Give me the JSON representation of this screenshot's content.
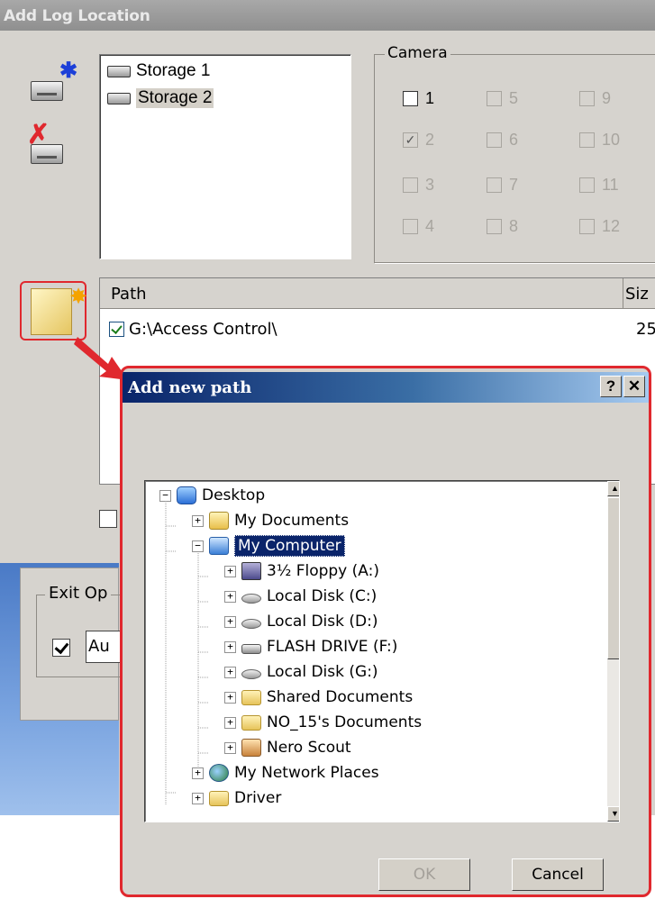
{
  "window": {
    "title": "Add Log Location"
  },
  "storage": {
    "items": [
      "Storage 1",
      "Storage 2"
    ]
  },
  "camera": {
    "legend": "Camera",
    "cameras": [
      {
        "label": "1",
        "checked": false,
        "enabled": true
      },
      {
        "label": "2",
        "checked": true,
        "enabled": false
      },
      {
        "label": "3",
        "checked": false,
        "enabled": false
      },
      {
        "label": "4",
        "checked": false,
        "enabled": false
      },
      {
        "label": "5",
        "checked": false,
        "enabled": false
      },
      {
        "label": "6",
        "checked": false,
        "enabled": false
      },
      {
        "label": "7",
        "checked": false,
        "enabled": false
      },
      {
        "label": "8",
        "checked": false,
        "enabled": false
      },
      {
        "label": "9",
        "checked": false,
        "enabled": false
      },
      {
        "label": "10",
        "checked": false,
        "enabled": false
      },
      {
        "label": "11",
        "checked": false,
        "enabled": false
      },
      {
        "label": "12",
        "checked": false,
        "enabled": false
      }
    ]
  },
  "path_table": {
    "columns": [
      "Path",
      "Siz"
    ],
    "rows": [
      {
        "checked": true,
        "path": "G:\\Access Control\\",
        "size": "25"
      }
    ]
  },
  "exit_options": {
    "legend": "Exit Op",
    "field_text": "Au"
  },
  "dialog": {
    "title": "Add new path",
    "help_glyph": "?",
    "close_glyph": "✕",
    "tree": [
      {
        "label": "Desktop",
        "expander": "−",
        "icon": "desktop-icon"
      },
      {
        "label": "My Documents",
        "expander": "+",
        "icon": "my-documents-icon"
      },
      {
        "label": "My Computer",
        "expander": "−",
        "icon": "my-computer-icon",
        "selected": true
      },
      {
        "label": "3½ Floppy (A:)",
        "expander": "+",
        "icon": "floppy-icon"
      },
      {
        "label": "Local Disk (C:)",
        "expander": "+",
        "icon": "hard-disk-icon"
      },
      {
        "label": "Local Disk (D:)",
        "expander": "+",
        "icon": "hard-disk-icon"
      },
      {
        "label": "FLASH DRIVE (F:)",
        "expander": "+",
        "icon": "flash-drive-icon"
      },
      {
        "label": "Local Disk (G:)",
        "expander": "+",
        "icon": "hard-disk-icon"
      },
      {
        "label": "Shared Documents",
        "expander": "+",
        "icon": "folder-icon"
      },
      {
        "label": "NO_15's Documents",
        "expander": "+",
        "icon": "folder-icon"
      },
      {
        "label": "Nero Scout",
        "expander": "+",
        "icon": "nero-scout-icon"
      },
      {
        "label": "My Network Places",
        "expander": "+",
        "icon": "network-places-icon"
      },
      {
        "label": "Driver",
        "expander": "+",
        "icon": "folder-icon"
      }
    ],
    "ok_label": "OK",
    "cancel_label": "Cancel"
  },
  "colors": {
    "highlight_red": "#e0282e",
    "selection_blue": "#0a246a",
    "dialog_bg": "#d6d3ce"
  }
}
